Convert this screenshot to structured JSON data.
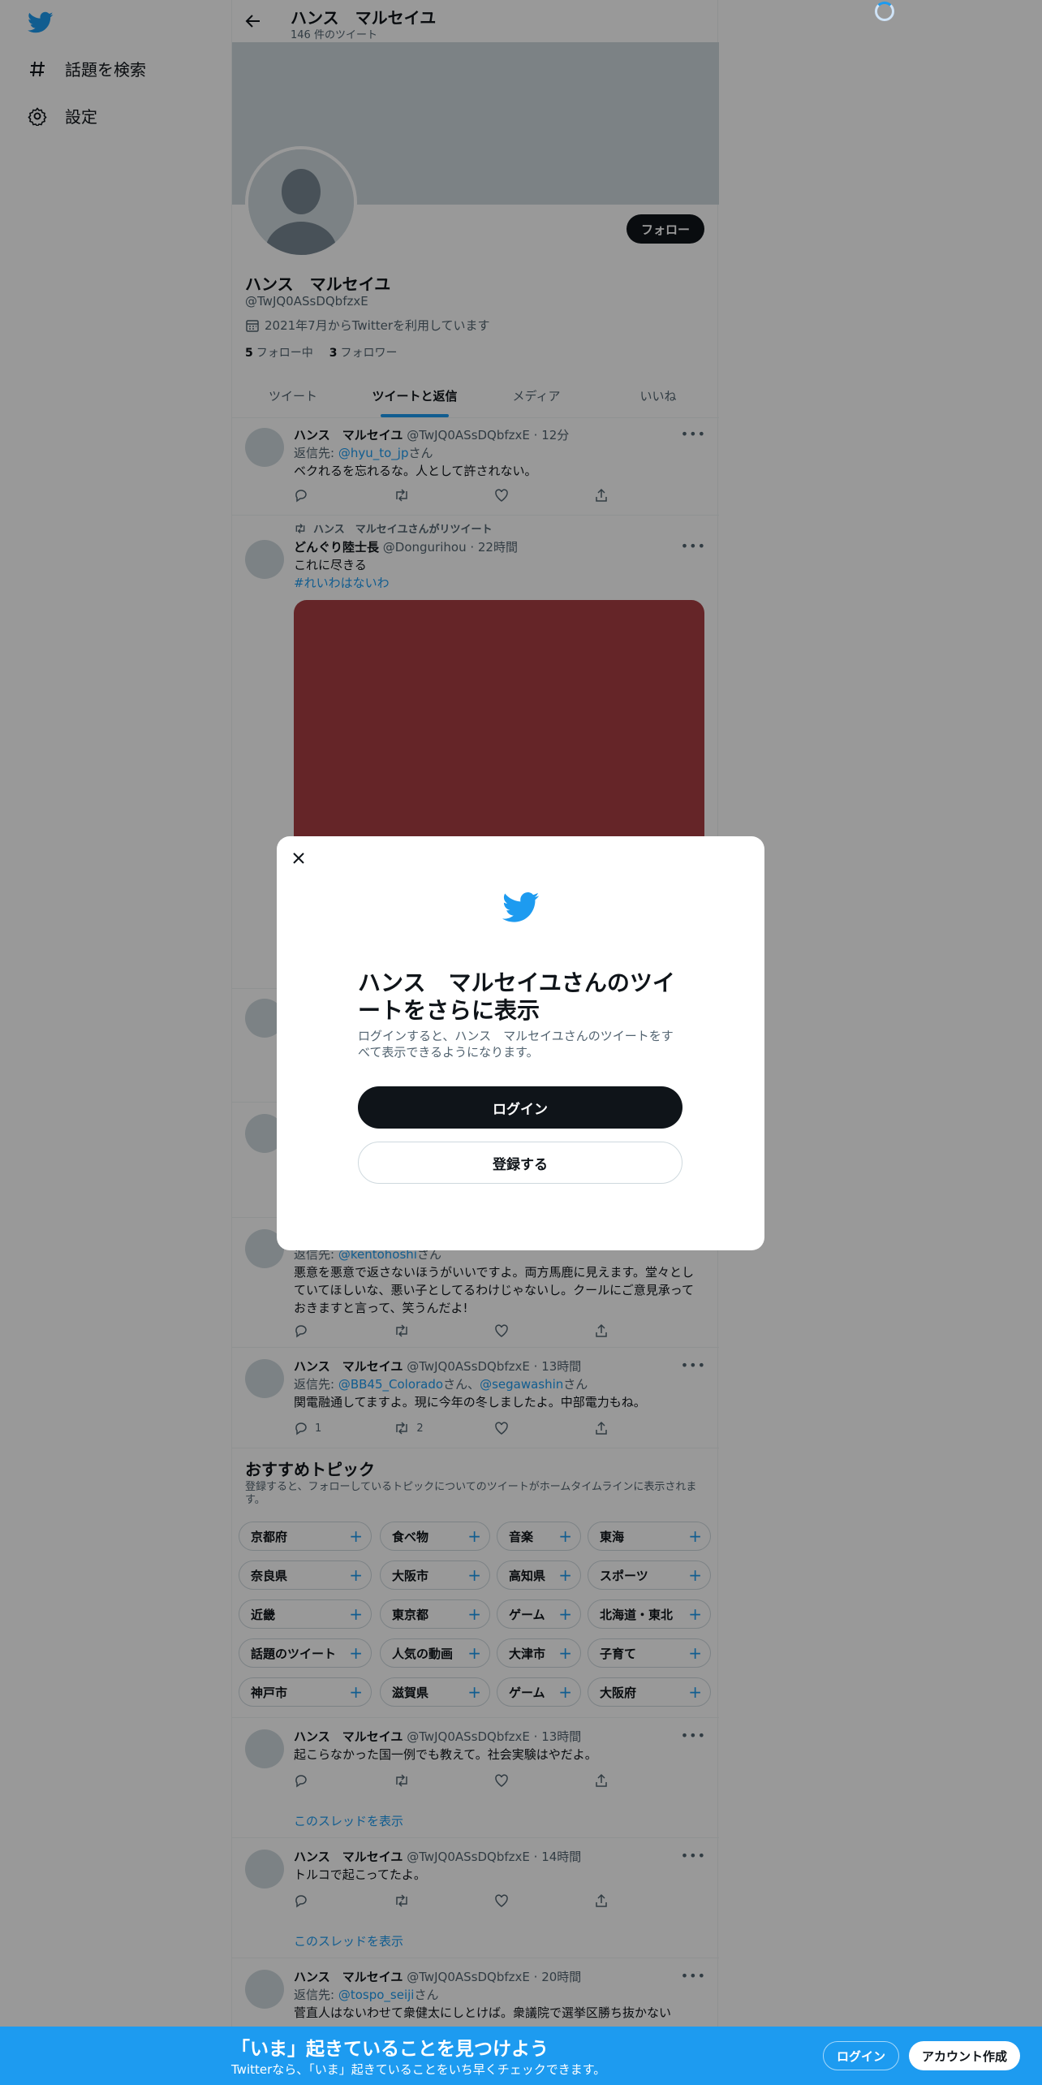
{
  "colors": {
    "brand": "#1d9bf0",
    "dark": "#0f1419",
    "secondary": "#536471",
    "media": "#a83f44"
  },
  "nav": {
    "items": [
      {
        "label": "話題を検索",
        "icon": "hashtag-icon"
      },
      {
        "label": "設定",
        "icon": "gear-icon"
      }
    ]
  },
  "header": {
    "name": "ハンス　マルセイユ",
    "count": "146 件のツイート"
  },
  "profile": {
    "name": "ハンス　マルセイユ",
    "handle": "@TwJQ0ASsDQbfzxE",
    "joined": "2021年7月からTwitterを利用しています",
    "following_num": "5",
    "following_label": "フォロー中",
    "followers_num": "3",
    "followers_label": "フォロワー",
    "follow_button": "フォロー"
  },
  "tabs": [
    "ツイート",
    "ツイートと返信",
    "メディア",
    "いいね"
  ],
  "tweets": [
    {
      "name": "ハンス　マルセイユ",
      "meta": "@TwJQ0ASsDQbfzxE · 12分",
      "reply_to_prefix": "返信先: ",
      "reply_to": "@hyu_to_jp",
      "reply_suffix": "さん",
      "text": "ベクれるを忘れるな。人として許されない。"
    },
    {
      "rt_label": "ハンス　マルセイユさんがリツイート",
      "name": "どんぐり陸士長",
      "meta": "@Dongurihou · 22時間",
      "text": "これに尽きる",
      "hashtag": "#れいわはないわ"
    },
    {
      "reply_to_prefix": "返信先: ",
      "reply_to": "@kentohoshi",
      "reply_suffix": "さん",
      "text1": "悪意を悪意で返さないほうがいいですよ。両方馬鹿に見えます。堂々とし",
      "text2": "ていてほしいな、悪い子としてるわけじゃないし。クールにご意見承って",
      "text3": "おきますと言って、笑うんだよ!"
    },
    {
      "name": "ハンス　マルセイユ",
      "meta": "@TwJQ0ASsDQbfzxE · 13時間",
      "reply_to_prefix": "返信先: ",
      "reply_to": "@BB45_Colorado",
      "reply_mid": "さん、",
      "reply_to2": "@segawashin",
      "reply_suffix": "さん",
      "text": "関電融通してますよ。現に今年の冬しましたよ。中部電力もね。",
      "replies": "1",
      "retweets": "2"
    },
    {
      "name": "ハンス　マルセイユ",
      "meta": "@TwJQ0ASsDQbfzxE · 13時間",
      "text": "起こらなかった国一例でも教えて。社会実験はやだよ。",
      "show_thread": "このスレッドを表示"
    },
    {
      "name": "ハンス　マルセイユ",
      "meta": "@TwJQ0ASsDQbfzxE · 14時間",
      "text": "トルコで起こってたよ。",
      "show_thread": "このスレッドを表示"
    },
    {
      "name": "ハンス　マルセイユ",
      "meta": "@TwJQ0ASsDQbfzxE · 20時間",
      "reply_to_prefix": "返信先: ",
      "reply_to": "@tospo_seiji",
      "reply_suffix": "さん",
      "text": "菅直人はないわせて衆健太にしとけば。衆議院で選挙区勝ち抜かない"
    }
  ],
  "topics": {
    "title": "おすすめトピック",
    "desc": "登録すると、フォローしているトピックについてのツイートがホームタイムラインに表示されます。",
    "chips": [
      "京都府",
      "食べ物",
      "音楽",
      "東海",
      "奈良県",
      "大阪市",
      "高知県",
      "スポーツ",
      "近畿",
      "東京都",
      "ゲーム",
      "北海道・東北",
      "話題のツイート",
      "人気の動画",
      "大津市",
      "子育て",
      "神戸市",
      "滋賀県",
      "ゲーム",
      "大阪府"
    ]
  },
  "modal": {
    "title": "ハンス　マルセイユさんのツイートをさらに表示",
    "subtitle": "ログインすると、ハンス　マルセイユさんのツイートをすべて表示できるようになります。",
    "login": "ログイン",
    "signup": "登録する"
  },
  "bottom": {
    "title": "「いま」起きていることを見つけよう",
    "subtitle": "Twitterなら、「いま」起きていることをいち早くチェックできます。",
    "login": "ログイン",
    "signup": "アカウント作成"
  }
}
